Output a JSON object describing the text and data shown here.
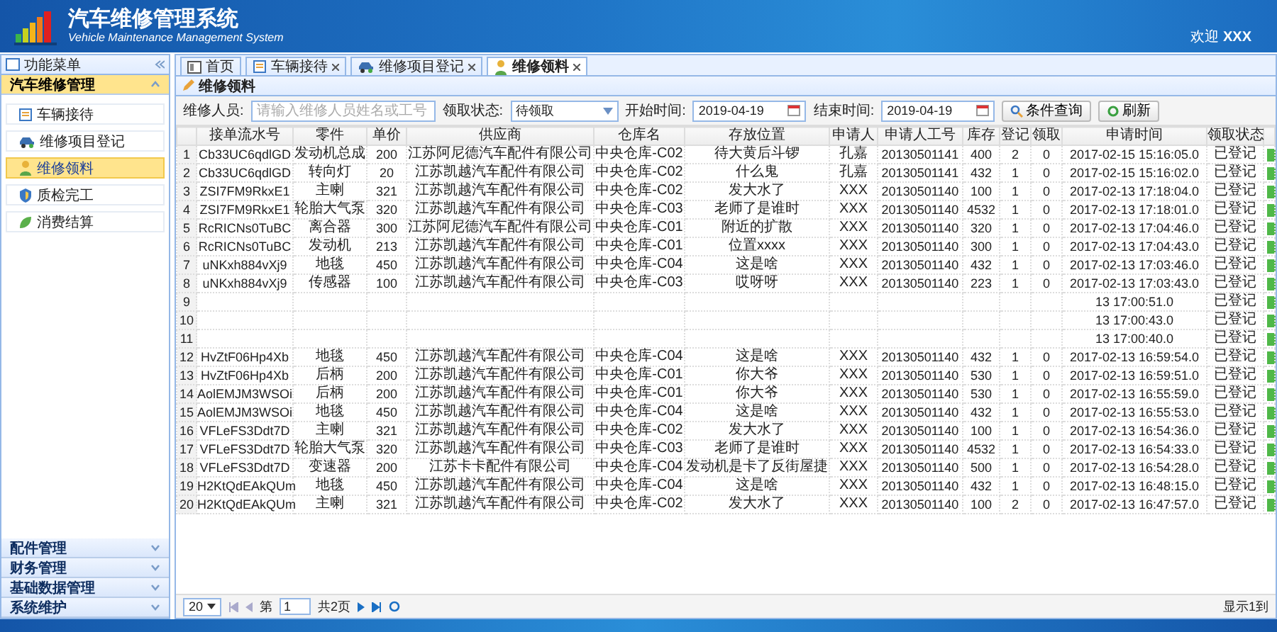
{
  "header": {
    "title": "汽车维修管理系统",
    "subtitle": "Vehicle Maintenance Management System",
    "welcome": "欢迎 **XXX**"
  },
  "sidebar": {
    "title": "功能菜单",
    "sections": [
      {
        "label": "汽车维修管理",
        "expanded": true,
        "items": [
          {
            "label": "车辆接待",
            "selected": false
          },
          {
            "label": "维修项目登记",
            "selected": false
          },
          {
            "label": "维修领料",
            "selected": true
          },
          {
            "label": "质检完工",
            "selected": false
          },
          {
            "label": "消费结算",
            "selected": false
          }
        ]
      },
      {
        "label": "配件管理",
        "expanded": false
      },
      {
        "label": "财务管理",
        "expanded": false
      },
      {
        "label": "基础数据管理",
        "expanded": false
      },
      {
        "label": "系统维护",
        "expanded": false
      }
    ]
  },
  "tabs": [
    {
      "label": "首页",
      "selected": false,
      "closable": false
    },
    {
      "label": "车辆接待",
      "selected": false,
      "closable": true
    },
    {
      "label": "维修项目登记",
      "selected": false,
      "closable": true
    },
    {
      "label": "维修领料",
      "selected": true,
      "closable": true
    }
  ],
  "panel_title": "维修领料",
  "filters": {
    "worker_label": "维修人员:",
    "worker_placeholder": "请输入维修人员姓名或工号",
    "status_label": "领取状态:",
    "status_value": "待领取",
    "start_label": "开始时间:",
    "start_value": "2019-04-19",
    "end_label": "结束时间:",
    "end_value": "2019-04-19",
    "search_button": "条件查询",
    "refresh_button": "刷新"
  },
  "table": {
    "columns": [
      "",
      "接单流水号",
      "零件",
      "单价",
      "供应商",
      "仓库名",
      "存放位置",
      "申请人",
      "申请人工号",
      "库存",
      "登记",
      "领取",
      "申请时间",
      "领取状态"
    ],
    "rows": [
      [
        "1",
        "Cb33UC6qdlGD",
        "发动机总成",
        "200",
        "江苏阿尼德汽车配件有限公司",
        "中央仓库-C02",
        "待大黄后斗锣",
        "孔嘉",
        "20130501141",
        "400",
        "2",
        "0",
        "2017-02-15 15:16:05.0",
        "已登记"
      ],
      [
        "2",
        "Cb33UC6qdlGD",
        "转向灯",
        "20",
        "江苏凯越汽车配件有限公司",
        "中央仓库-C02",
        "什么鬼",
        "孔嘉",
        "20130501141",
        "432",
        "1",
        "0",
        "2017-02-15 15:16:02.0",
        "已登记"
      ],
      [
        "3",
        "ZSI7FM9RkxE1",
        "主喇",
        "321",
        "江苏凯越汽车配件有限公司",
        "中央仓库-C02",
        "发大水了",
        "XXX",
        "20130501140",
        "100",
        "1",
        "0",
        "2017-02-13 17:18:04.0",
        "已登记"
      ],
      [
        "4",
        "ZSI7FM9RkxE1",
        "轮胎大气泵",
        "320",
        "江苏凯越汽车配件有限公司",
        "中央仓库-C03",
        "老师了是谁时",
        "XXX",
        "20130501140",
        "4532",
        "1",
        "0",
        "2017-02-13 17:18:01.0",
        "已登记"
      ],
      [
        "5",
        "RcRICNs0TuBC",
        "离合器",
        "300",
        "江苏阿尼德汽车配件有限公司",
        "中央仓库-C01",
        "附近的扩散",
        "XXX",
        "20130501140",
        "320",
        "1",
        "0",
        "2017-02-13 17:04:46.0",
        "已登记"
      ],
      [
        "6",
        "RcRICNs0TuBC",
        "发动机",
        "213",
        "江苏凯越汽车配件有限公司",
        "中央仓库-C01",
        "位置xxxx",
        "XXX",
        "20130501140",
        "300",
        "1",
        "0",
        "2017-02-13 17:04:43.0",
        "已登记"
      ],
      [
        "7",
        "uNKxh884vXj9",
        "地毯",
        "450",
        "江苏凯越汽车配件有限公司",
        "中央仓库-C04",
        "这是啥",
        "XXX",
        "20130501140",
        "432",
        "1",
        "0",
        "2017-02-13 17:03:46.0",
        "已登记"
      ],
      [
        "8",
        "uNKxh884vXj9",
        "传感器",
        "100",
        "江苏凯越汽车配件有限公司",
        "中央仓库-C03",
        "哎呀呀",
        "XXX",
        "20130501140",
        "223",
        "1",
        "0",
        "2017-02-13 17:03:43.0",
        "已登记"
      ],
      [
        "9",
        null,
        null,
        null,
        null,
        null,
        null,
        null,
        null,
        null,
        null,
        null,
        "13 17:00:51.0",
        "已登记"
      ],
      [
        "10",
        null,
        null,
        null,
        null,
        null,
        null,
        null,
        null,
        null,
        null,
        null,
        "13 17:00:43.0",
        "已登记"
      ],
      [
        "11",
        null,
        null,
        null,
        null,
        null,
        null,
        null,
        null,
        null,
        null,
        null,
        "13 17:00:40.0",
        "已登记"
      ],
      [
        "12",
        "HvZtF06Hp4Xb",
        "地毯",
        "450",
        "江苏凯越汽车配件有限公司",
        "中央仓库-C04",
        "这是啥",
        "XXX",
        "20130501140",
        "432",
        "1",
        "0",
        "2017-02-13 16:59:54.0",
        "已登记"
      ],
      [
        "13",
        "HvZtF06Hp4Xb",
        "后柄",
        "200",
        "江苏凯越汽车配件有限公司",
        "中央仓库-C01",
        "你大爷",
        "XXX",
        "20130501140",
        "530",
        "1",
        "0",
        "2017-02-13 16:59:51.0",
        "已登记"
      ],
      [
        "14",
        "AolEMJM3WSOi",
        "后柄",
        "200",
        "江苏凯越汽车配件有限公司",
        "中央仓库-C01",
        "你大爷",
        "XXX",
        "20130501140",
        "530",
        "1",
        "0",
        "2017-02-13 16:55:59.0",
        "已登记"
      ],
      [
        "15",
        "AolEMJM3WSOi",
        "地毯",
        "450",
        "江苏凯越汽车配件有限公司",
        "中央仓库-C04",
        "这是啥",
        "XXX",
        "20130501140",
        "432",
        "1",
        "0",
        "2017-02-13 16:55:53.0",
        "已登记"
      ],
      [
        "16",
        "VFLeFS3Ddt7D",
        "主喇",
        "321",
        "江苏凯越汽车配件有限公司",
        "中央仓库-C02",
        "发大水了",
        "XXX",
        "20130501140",
        "100",
        "1",
        "0",
        "2017-02-13 16:54:36.0",
        "已登记"
      ],
      [
        "17",
        "VFLeFS3Ddt7D",
        "轮胎大气泵",
        "320",
        "江苏凯越汽车配件有限公司",
        "中央仓库-C03",
        "老师了是谁时",
        "XXX",
        "20130501140",
        "4532",
        "1",
        "0",
        "2017-02-13 16:54:33.0",
        "已登记"
      ],
      [
        "18",
        "VFLeFS3Ddt7D",
        "变速器",
        "200",
        "江苏卡卡配件有限公司",
        "中央仓库-C04",
        "发动机是卡了反街屋捷",
        "XXX",
        "20130501140",
        "500",
        "1",
        "0",
        "2017-02-13 16:54:28.0",
        "已登记"
      ],
      [
        "19",
        "H2KtQdEAkQUm",
        "地毯",
        "450",
        "江苏凯越汽车配件有限公司",
        "中央仓库-C04",
        "这是啥",
        "XXX",
        "20130501140",
        "432",
        "1",
        "0",
        "2017-02-13 16:48:15.0",
        "已登记"
      ],
      [
        "20",
        "H2KtQdEAkQUm",
        "主喇",
        "321",
        "江苏凯越汽车配件有限公司",
        "中央仓库-C02",
        "发大水了",
        "XXX",
        "20130501140",
        "100",
        "2",
        "0",
        "2017-02-13 16:47:57.0",
        "已登记"
      ]
    ]
  },
  "pager": {
    "page_size": "20",
    "page_label": "第",
    "page": "1",
    "total": "共2页",
    "info": "显示1到"
  }
}
